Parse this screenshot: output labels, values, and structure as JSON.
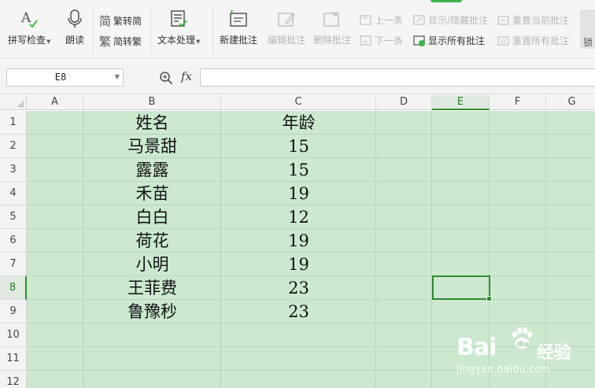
{
  "ribbon": {
    "spell_check": "拼写检查",
    "read_aloud": "朗读",
    "trad_to_simp": "繁转简",
    "simp_to_trad": "简转繁",
    "text_processing": "文本处理",
    "new_comment": "新建批注",
    "edit_comment": "编辑批注",
    "delete_comment": "删除批注",
    "prev_comment": "上一条",
    "next_comment": "下一条",
    "show_hide_comment": "显示/隐藏批注",
    "show_all_comments": "显示所有批注",
    "reset_current_comment": "重置当前批注",
    "reset_all_comments": "重置所有批注",
    "lock": "锁"
  },
  "formula_bar": {
    "name_box": "E8",
    "fx_label": "fx",
    "formula": ""
  },
  "grid": {
    "columns": [
      "A",
      "B",
      "C",
      "D",
      "E",
      "F",
      "G"
    ],
    "rows": [
      "1",
      "2",
      "3",
      "4",
      "5",
      "6",
      "7",
      "8",
      "9",
      "10",
      "11",
      "12"
    ],
    "selected_cell": "E8",
    "data": [
      {
        "name": "姓名",
        "age": "年龄"
      },
      {
        "name": "马景甜",
        "age": "15"
      },
      {
        "name": "露露",
        "age": "15"
      },
      {
        "name": "禾苗",
        "age": "19"
      },
      {
        "name": "白白",
        "age": "12"
      },
      {
        "name": "荷花",
        "age": "19"
      },
      {
        "name": "小明",
        "age": "19"
      },
      {
        "name": "王菲费",
        "age": "23"
      },
      {
        "name": "鲁豫秒",
        "age": "23"
      }
    ]
  },
  "watermark": {
    "brand": "Bai",
    "brand2": "du",
    "cn": "经验",
    "url": "jingyan.baidu.com"
  },
  "colors": {
    "cell_bg": "#cce8cf",
    "selection": "#2e8b2e"
  }
}
